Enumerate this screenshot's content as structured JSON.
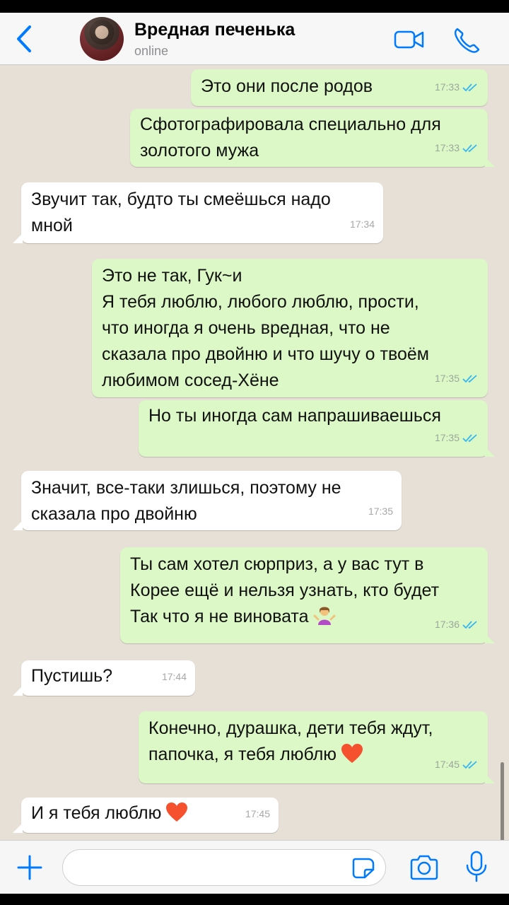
{
  "header": {
    "contact_name": "Вредная печенька",
    "status": "online"
  },
  "colors": {
    "accent": "#007aff",
    "outgoing_bubble": "#dcf8c6",
    "incoming_bubble": "#ffffff",
    "chat_background": "#e6e0d6",
    "read_ticks": "#34b7f1"
  },
  "icons": {
    "back": "chevron-left-icon",
    "video": "video-camera-icon",
    "call": "phone-icon",
    "attach": "plus-icon",
    "sticker": "sticker-icon",
    "camera": "camera-icon",
    "mic": "microphone-icon",
    "read": "double-check-icon"
  },
  "messages": [
    {
      "dir": "out",
      "text": "Это они после родов",
      "time": "17:33"
    },
    {
      "dir": "out",
      "text": "Сфотографировала специально для\nзолотого мужа",
      "time": "17:33"
    },
    {
      "dir": "in",
      "text": "Звучит так, будто ты смеёшься надо\nмной",
      "time": "17:34"
    },
    {
      "dir": "out",
      "text": "Это не так, Гук~и\nЯ тебя люблю, любого люблю, прости,\nчто иногда я очень вредная, что не\nсказала про двойню и что шучу о твоём\nлюбимом сосед-Хёне",
      "time": "17:35"
    },
    {
      "dir": "out",
      "text": "Но ты иногда сам напрашиваешься",
      "time": "17:35"
    },
    {
      "dir": "in",
      "text": "Значит, все-таки злишься, поэтому не\nсказала про двойню",
      "time": "17:35"
    },
    {
      "dir": "out",
      "text": "Ты сам хотел сюрприз, а у вас тут в\nКорее ещё и нельзя узнать, кто будет\nТак что я не виновата",
      "time": "17:36",
      "emoji": "person-shrugging"
    },
    {
      "dir": "in",
      "text": "Пустишь?",
      "time": "17:44"
    },
    {
      "dir": "out",
      "text": "Конечно, дурашка, дети тебя ждут,\nпапочка, я тебя люблю",
      "time": "17:45",
      "emoji": "red-heart"
    },
    {
      "dir": "in",
      "text": "И я тебя люблю",
      "time": "17:45",
      "emoji": "red-heart"
    }
  ],
  "composer": {
    "placeholder": ""
  }
}
